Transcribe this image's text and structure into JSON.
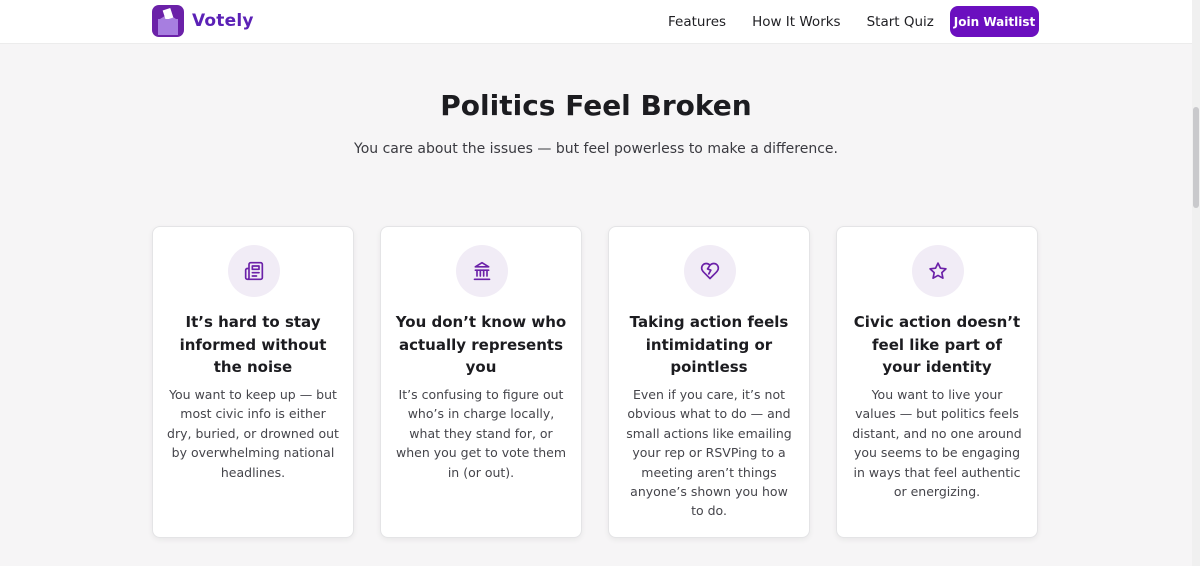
{
  "brand": {
    "name": "Votely",
    "accent": "#6b21a8",
    "logo_icon": "ballot-box-icon"
  },
  "nav": {
    "links": [
      "Features",
      "How It Works",
      "Start Quiz"
    ],
    "cta": "Join Waitlist",
    "cta_color": "#6b0fbf"
  },
  "hero": {
    "title": "Politics Feel Broken",
    "subtitle": "You care about the issues — but feel powerless to make a difference."
  },
  "cards": [
    {
      "icon": "newspaper-icon",
      "title": "It’s hard to stay informed without the noise",
      "body": "You want to keep up — but most civic info is either dry, buried, or drowned out by overwhelming national headlines."
    },
    {
      "icon": "government-building-icon",
      "title": "You don’t know who actually represents you",
      "body": "It’s confusing to figure out who’s in charge locally, what they stand for, or when you get to vote them in (or out)."
    },
    {
      "icon": "broken-heart-icon",
      "title": "Taking action feels intimidating or pointless",
      "body": "Even if you care, it’s not obvious what to do — and small actions like emailing your rep or RSVPing to a meeting aren’t things anyone’s shown you how to do."
    },
    {
      "icon": "star-icon",
      "title": "Civic action doesn’t feel like part of your identity",
      "body": "You want to live your values — but politics feels distant, and no one around you seems to be engaging in ways that feel authentic or energizing."
    }
  ],
  "colors": {
    "icon_stroke": "#6b21a8",
    "icon_bg": "#f1ecf6",
    "page_bg": "#f6f5f6"
  }
}
